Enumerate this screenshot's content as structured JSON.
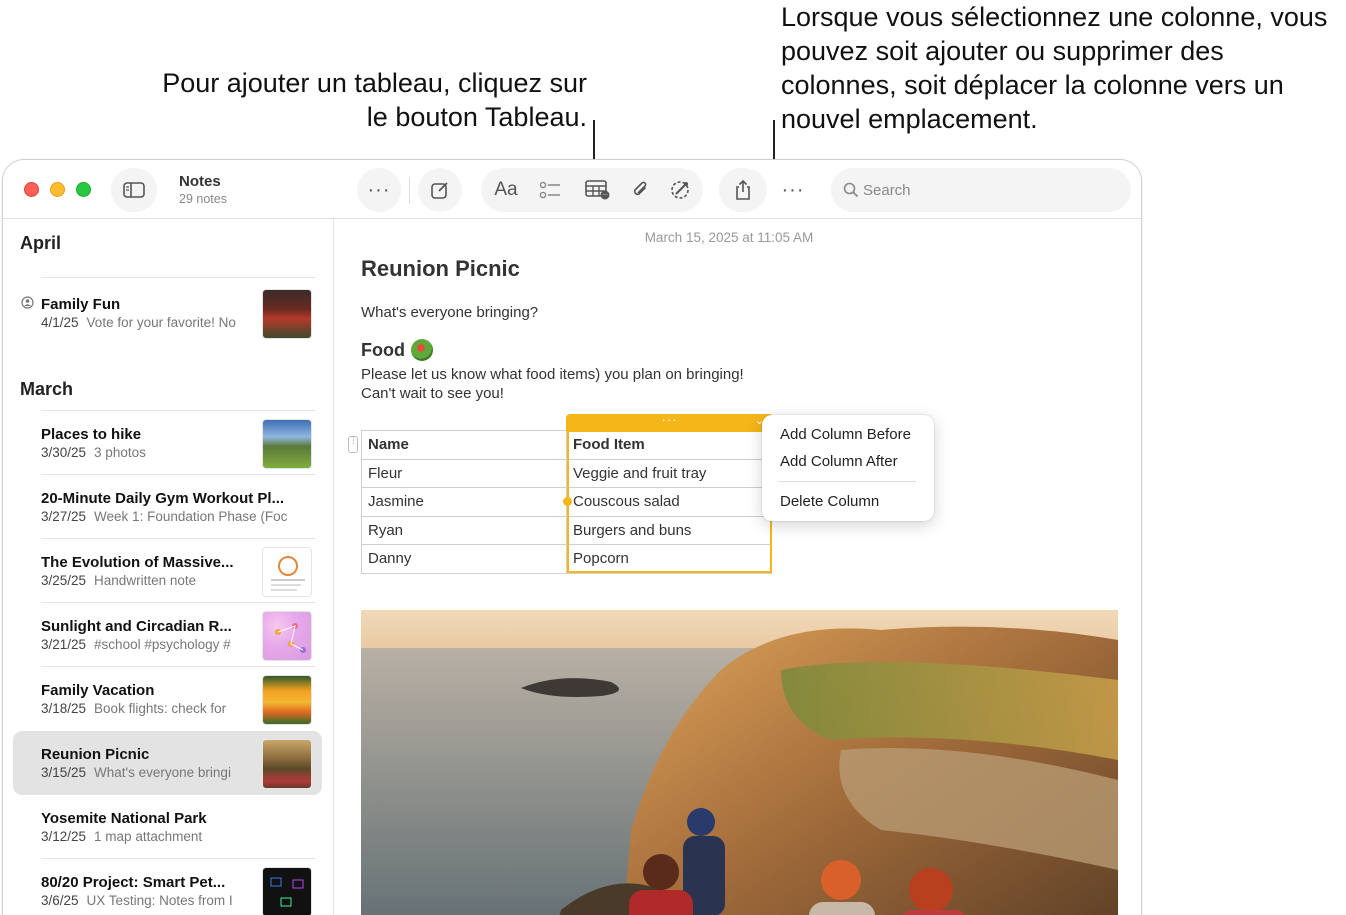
{
  "callouts": {
    "left": "Pour ajouter un tableau, cliquez sur le bouton Tableau.",
    "right": "Lorsque vous sélectionnez une colonne, vous pouvez soit ajouter ou supprimer des colonnes, soit déplacer la colonne vers un nouvel emplacement."
  },
  "toolbar": {
    "app_name": "Notes",
    "note_count": "29 notes",
    "format_label": "Aa",
    "search_placeholder": "Search",
    "icons": [
      "sidebar-icon",
      "more-icon",
      "compose-icon",
      "format-icon",
      "checklist-icon",
      "table-icon",
      "attachment-icon",
      "collaborate-icon",
      "share-icon",
      "more-icon",
      "search-icon"
    ]
  },
  "sidebar": {
    "sections": [
      {
        "header": "April",
        "notes": [
          {
            "title": "Family Fun",
            "date": "4/1/25",
            "preview": "Vote for your favorite! No",
            "shared": true
          }
        ]
      },
      {
        "header": "March",
        "notes": [
          {
            "title": "Places to hike",
            "date": "3/30/25",
            "preview": "3 photos"
          },
          {
            "title": "20-Minute Daily Gym Workout Pl...",
            "date": "3/27/25",
            "preview": "Week 1: Foundation Phase (Foc"
          },
          {
            "title": "The Evolution of Massive...",
            "date": "3/25/25",
            "preview": "Handwritten note"
          },
          {
            "title": "Sunlight and Circadian R...",
            "date": "3/21/25",
            "preview": "#school #psychology #"
          },
          {
            "title": "Family Vacation",
            "date": "3/18/25",
            "preview": "Book flights: check for"
          },
          {
            "title": "Reunion Picnic",
            "date": "3/15/25",
            "preview": "What's everyone bringi",
            "selected": true
          },
          {
            "title": "Yosemite National Park",
            "date": "3/12/25",
            "preview": "1 map attachment"
          },
          {
            "title": "80/20 Project: Smart Pet...",
            "date": "3/6/25",
            "preview": "UX Testing: Notes from I"
          }
        ]
      }
    ]
  },
  "note": {
    "timestamp": "March 15, 2025 at 11:05 AM",
    "title": "Reunion Picnic",
    "intro": "What's everyone bringing?",
    "heading": "Food",
    "body_line1": "Please let us know what food items) you plan on bringing!",
    "body_line2": "Can't wait to see you!",
    "table": {
      "headers": [
        "Name",
        "Food Item"
      ],
      "rows": [
        [
          "Fleur",
          "Veggie and fruit tray"
        ],
        [
          "Jasmine",
          "Couscous salad"
        ],
        [
          "Ryan",
          "Burgers and buns"
        ],
        [
          "Danny",
          "Popcorn"
        ]
      ],
      "selected_column": 1
    }
  },
  "column_menu": {
    "items": [
      "Add Column Before",
      "Add Column After",
      "Delete Column"
    ]
  },
  "colors": {
    "selection": "#f5b61a",
    "close": "#fe5f57",
    "minimize": "#febc2e",
    "zoom": "#28c840"
  }
}
